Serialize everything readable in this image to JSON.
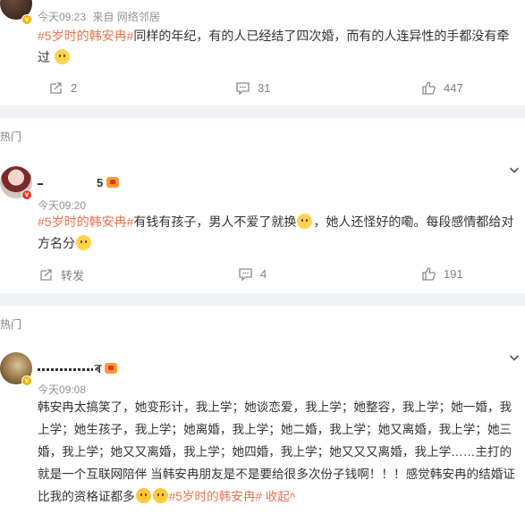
{
  "post1": {
    "time": "今天09:23",
    "source": "来自 网络邻居",
    "hashtag": "#5岁时的韩安冉#",
    "text": "同样的年纪，有的人已经结了四次婚，而有的人连异性的手都没有牵过",
    "actions": {
      "repost": "2",
      "comment": "31",
      "like": "447"
    }
  },
  "sections": {
    "hot_label_1": "热门",
    "hot_label_2": "热门"
  },
  "comment1": {
    "username": "5",
    "time": "今天09:20",
    "hashtag": "#5岁时的韩安冉#",
    "text_a": "有钱有孩子，男人不爱了就换",
    "text_b": "，她人还怪好的嘞。每段感情都给对方名分",
    "actions": {
      "repost": "转发",
      "comment": "4",
      "like": "191"
    }
  },
  "comment2": {
    "username": "ৰ",
    "time": "今天09:08",
    "text": "韩安冉太搞笑了，她变形计，我上学；她谈恋爱，我上学；她整容，我上学；她一婚，我上学；她生孩子，我上学；她离婚，我上学；她二婚，我上学；她又离婚，我上学；她三婚，我上学；她又又离婚，我上学；她四婚，我上学；她又又又离婚，我上学……主打的就是一个互联网陪伴 当韩安冉朋友是不是要给很多次份子钱啊！！！感觉韩安冉的结婚证比我的资格证都多",
    "hashtag": "#5岁时的韩安冉#",
    "fold": "收起"
  },
  "colors": {
    "accent": "#eb7350",
    "muted": "#939393",
    "divider": "#f1f2f5",
    "badge": "#f7b500"
  },
  "icons": [
    "repost-icon",
    "comment-icon",
    "like-icon",
    "chevron-down-icon",
    "verified-badge-icon",
    "crown-badge-icon",
    "emoji-icon",
    "cry-emoji-icon"
  ]
}
